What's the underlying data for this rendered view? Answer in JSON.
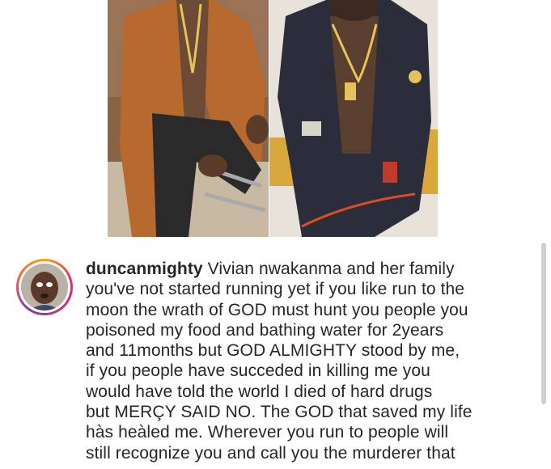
{
  "post": {
    "username": "duncanmighty",
    "caption_lines": [
      "Vivian nwakanma and her family",
      "you've not started running yet if you like run to the",
      "moon the wrath of GOD must hunt you people you",
      "poisoned my food and bathing water for 2years",
      "and 11months but GOD ALMIGHTY stood by me,",
      "if you people have succeded in killing me you",
      "would have told the world I died of hard drugs",
      "but MERÇY SAID NO.  The GOD that saved my life",
      "hàs heàled me. Wherever you run to people will",
      "still recognize you and call you the murderer that"
    ]
  },
  "photos": {
    "left": "man-in-tan-coat-photo",
    "right": "man-in-denim-jacket-photo"
  },
  "colors": {
    "avatar_ring": "#e1306c",
    "text": "#262626",
    "background": "#ffffff"
  }
}
